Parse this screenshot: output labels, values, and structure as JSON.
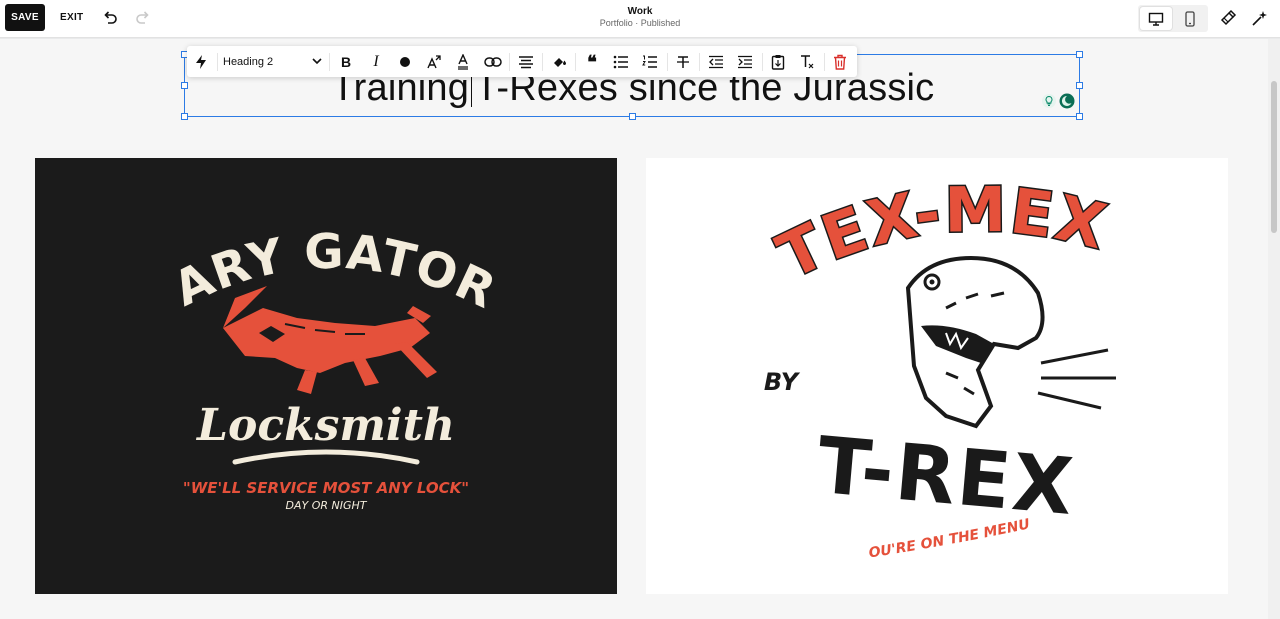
{
  "topbar": {
    "save_label": "SAVE",
    "exit_label": "EXIT",
    "page_title": "Work",
    "page_subtitle": "Portfolio · Published"
  },
  "toolbar": {
    "style_select_value": "Heading 2"
  },
  "heading": {
    "text_before_cursor": "Training",
    "text_after_cursor": "T-Rexes since the Jurassic"
  },
  "images": {
    "left": {
      "title": "GARY GATORS",
      "subtitle": "Locksmith",
      "tagline": "\"WE'LL SERVICE MOST ANY LOCK\"",
      "small": "DAY OR NIGHT"
    },
    "right": {
      "title": "TEX-MEX",
      "by": "BY",
      "name": "T-REX",
      "tagline": "\"YOU'RE ON THE MENU!\""
    }
  },
  "colors": {
    "accent_red": "#e5513b",
    "cream": "#f3ecdc",
    "selection_blue": "#2c7be5",
    "dark_bg": "#1b1b1b",
    "delete_red": "#d9302c"
  },
  "icons": [
    "undo-icon",
    "redo-icon",
    "desktop-icon",
    "mobile-icon",
    "paint-brush-icon",
    "sparkle-icon",
    "lightning-icon",
    "chevron-down-icon",
    "bold-icon",
    "italic-icon",
    "color-dot-icon",
    "text-size-icon",
    "text-color-icon",
    "link-icon",
    "align-center-icon",
    "highlight-icon",
    "quote-icon",
    "bulleted-list-icon",
    "numbered-list-icon",
    "strikethrough-icon",
    "outdent-icon",
    "indent-icon",
    "paste-icon",
    "clear-format-icon",
    "trash-icon"
  ]
}
